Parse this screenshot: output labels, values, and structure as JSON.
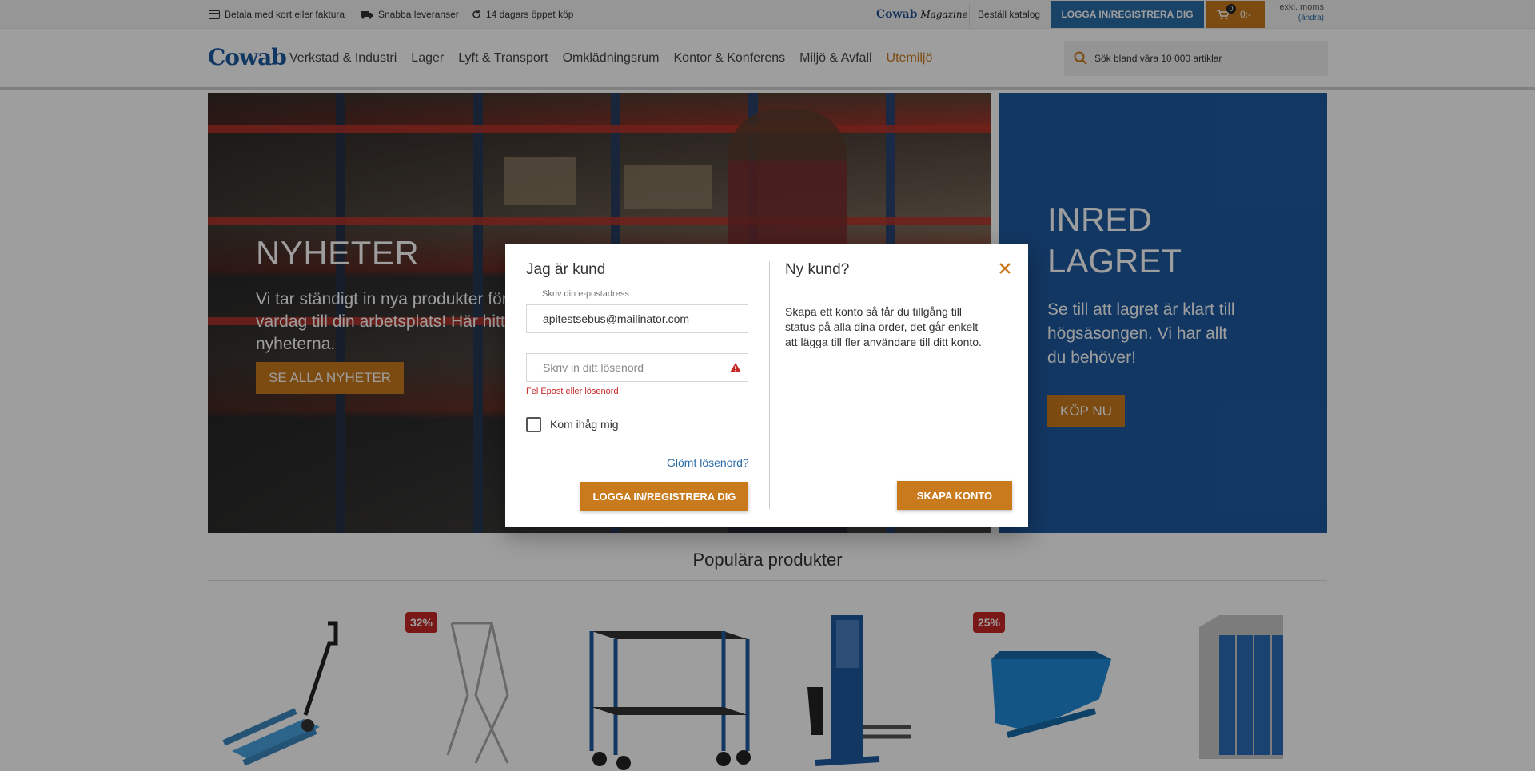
{
  "topbar": {
    "usp": [
      {
        "icon": "card-icon",
        "label": "Betala med kort eller faktura"
      },
      {
        "icon": "truck-icon",
        "label": "Snabba leveranser"
      },
      {
        "icon": "refresh-icon",
        "label": "14 dagars öppet köp"
      }
    ],
    "magazine_brand": "Cowab",
    "magazine_script": "Magazine",
    "catalog_link": "Beställ katalog",
    "login_label": "LOGGA IN/REGISTRERA DIG",
    "cart_count": "0",
    "cart_total": "0:-",
    "vat_label": "exkl. moms",
    "vat_change": "(ändra)"
  },
  "nav": {
    "logo": "Cowab",
    "items": [
      "Verkstad & Industri",
      "Lager",
      "Lyft & Transport",
      "Omklädningsrum",
      "Kontor & Konferens",
      "Miljö & Avfall",
      "Utemiljö"
    ],
    "search_placeholder": "Sök bland våra 10 000 artiklar"
  },
  "hero": {
    "title": "NYHETER",
    "text": "Vi tar ständigt in nya produkter för att förbättra din vardag till din arbetsplats! Här hittar du de senaste nyheterna.",
    "button": "SE ALLA NYHETER"
  },
  "promo": {
    "title_line1": "INRED",
    "title_line2": "LAGRET",
    "text": "Se till att lagret är klart till högsäsongen. Vi har allt du behöver!",
    "button": "KÖP NU"
  },
  "popular": {
    "title": "Populära produkter",
    "products": [
      {
        "name": "pallet-truck",
        "badge": ""
      },
      {
        "name": "bag-holder",
        "badge": "32%"
      },
      {
        "name": "workshop-trolley",
        "badge": ""
      },
      {
        "name": "stacker",
        "badge": ""
      },
      {
        "name": "tipping-skip",
        "badge": "25%"
      },
      {
        "name": "locker",
        "badge": ""
      }
    ]
  },
  "modal": {
    "existing_title": "Jag är kund",
    "email_label": "Skriv din e-postadress",
    "email_value": "apitestsebus@mailinator.com",
    "password_placeholder": "Skriv in ditt lösenord",
    "error_text": "Fel Epost eller lösenord",
    "remember_label": "Kom ihåg mig",
    "forgot_link": "Glömt lösenord?",
    "login_button": "LOGGA IN/REGISTRERA DIG",
    "new_title": "Ny kund?",
    "new_text": "Skapa ett konto så får du tillgång till status på alla dina order, det går enkelt att lägga till fler användare till ditt konto.",
    "create_button": "SKAPA KONTO"
  },
  "colors": {
    "brand_blue": "#1d5aa0",
    "accent_orange": "#c97a1c",
    "error_red": "#c62828",
    "link_blue": "#2a6ca8"
  }
}
